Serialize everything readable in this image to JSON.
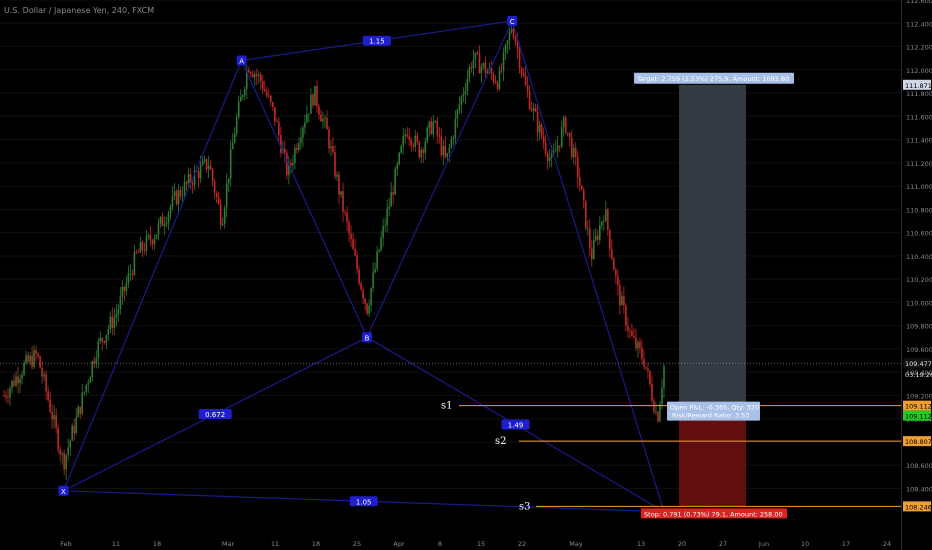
{
  "header": {
    "symbol_title": "U.S. Dollar / Japanese Yen, 240, FXCM"
  },
  "colors": {
    "background": "#000000",
    "candle_up": "#2e7d32",
    "candle_down": "#c62828",
    "pattern_line": "#1a1a8c",
    "pattern_label_bg": "#1f1fd0",
    "target_zone": "#3a4048",
    "stop_zone": "#6b0f0f",
    "orange_line": "#f0a030",
    "axis_text": "#8a8a8a",
    "current_price_tag": "#e8e8e8",
    "current_line": "#9aa0a6"
  },
  "chart_data": {
    "type": "candlestick",
    "title": "U.S. Dollar / Japanese Yen, 240, FXCM",
    "ylim": [
      108.0,
      112.6
    ],
    "y_ticks": [
      "112.600",
      "112.400",
      "112.200",
      "112.000",
      "111.800",
      "111.600",
      "111.400",
      "111.200",
      "111.000",
      "110.800",
      "110.600",
      "110.400",
      "110.200",
      "110.000",
      "109.800",
      "109.600",
      "109.400",
      "109.200",
      "109.000",
      "108.800",
      "108.600",
      "108.400"
    ],
    "x_ticks": [
      "Feb",
      "11",
      "18",
      "Mar",
      "11",
      "18",
      "25",
      "Apr",
      "8",
      "15",
      "22",
      "May",
      "13",
      "20",
      "27",
      "Jun",
      "10",
      "17",
      "24"
    ],
    "price_path": [
      {
        "t": 0,
        "p": 109.2
      },
      {
        "t": 3,
        "p": 109.45
      },
      {
        "t": 5,
        "p": 109.55
      },
      {
        "t": 7,
        "p": 109.1
      },
      {
        "t": 9,
        "p": 108.62
      },
      {
        "t": 11,
        "p": 109.0
      },
      {
        "t": 14,
        "p": 109.6
      },
      {
        "t": 17,
        "p": 109.9
      },
      {
        "t": 20,
        "p": 110.4
      },
      {
        "t": 23,
        "p": 110.6
      },
      {
        "t": 26,
        "p": 110.9
      },
      {
        "t": 29,
        "p": 111.1
      },
      {
        "t": 31,
        "p": 111.2
      },
      {
        "t": 33,
        "p": 110.7
      },
      {
        "t": 35,
        "p": 111.5
      },
      {
        "t": 37,
        "p": 112.05
      },
      {
        "t": 39,
        "p": 111.9
      },
      {
        "t": 41,
        "p": 111.6
      },
      {
        "t": 43,
        "p": 111.1
      },
      {
        "t": 45,
        "p": 111.5
      },
      {
        "t": 47,
        "p": 111.8
      },
      {
        "t": 49,
        "p": 111.45
      },
      {
        "t": 51,
        "p": 110.9
      },
      {
        "t": 53,
        "p": 110.4
      },
      {
        "t": 55,
        "p": 109.95
      },
      {
        "t": 57,
        "p": 110.5
      },
      {
        "t": 59,
        "p": 111.0
      },
      {
        "t": 61,
        "p": 111.5
      },
      {
        "t": 63,
        "p": 111.3
      },
      {
        "t": 65,
        "p": 111.55
      },
      {
        "t": 67,
        "p": 111.2
      },
      {
        "t": 69,
        "p": 111.7
      },
      {
        "t": 71,
        "p": 112.1
      },
      {
        "t": 73,
        "p": 112.0
      },
      {
        "t": 75,
        "p": 111.9
      },
      {
        "t": 77,
        "p": 112.4
      },
      {
        "t": 79,
        "p": 111.85
      },
      {
        "t": 81,
        "p": 111.5
      },
      {
        "t": 83,
        "p": 111.2
      },
      {
        "t": 85,
        "p": 111.55
      },
      {
        "t": 87,
        "p": 111.1
      },
      {
        "t": 89,
        "p": 110.4
      },
      {
        "t": 91,
        "p": 110.8
      },
      {
        "t": 93,
        "p": 110.1
      },
      {
        "t": 95,
        "p": 109.7
      },
      {
        "t": 97,
        "p": 109.5
      },
      {
        "t": 99,
        "p": 109.0
      },
      {
        "t": 100,
        "p": 109.45
      }
    ],
    "pattern": {
      "points": [
        {
          "label": "X",
          "t": 9,
          "p": 108.38
        },
        {
          "label": "A",
          "t": 36,
          "p": 112.08
        },
        {
          "label": "B",
          "t": 55,
          "p": 109.7
        },
        {
          "label": "C",
          "t": 77,
          "p": 112.42
        },
        {
          "label": "D",
          "t": 100,
          "p": 108.2
        }
      ],
      "ratios": [
        {
          "label": "1.15",
          "between": "A-C"
        },
        {
          "label": "0.672",
          "between": "X-B"
        },
        {
          "label": "1.49",
          "between": "B-D"
        },
        {
          "label": "1.05",
          "between": "X-D"
        }
      ]
    },
    "levels": [
      {
        "name": "s1",
        "value": 109.112,
        "tag": "109.112"
      },
      {
        "name": "s2",
        "value": 108.807,
        "tag": "108.807"
      },
      {
        "name": "s3",
        "value": 108.246,
        "tag": "108.246"
      }
    ],
    "current_price": {
      "value": 109.477,
      "tag": "109.477",
      "countdown": "03:19:26"
    },
    "target_price_tag": "111.871",
    "green_tag": "109.112",
    "position": {
      "target_label": "Target: 2.759 (2.53%) 275.9, Amount: 1092.80",
      "open_pl_label": "Open P&L: -0.365, Qty: 320",
      "risk_reward_label": "Risk/Reward Ratio: 3.53",
      "stop_label": "Stop: 0.791 (0.73%) 79.1, Amount: 258.00"
    }
  }
}
